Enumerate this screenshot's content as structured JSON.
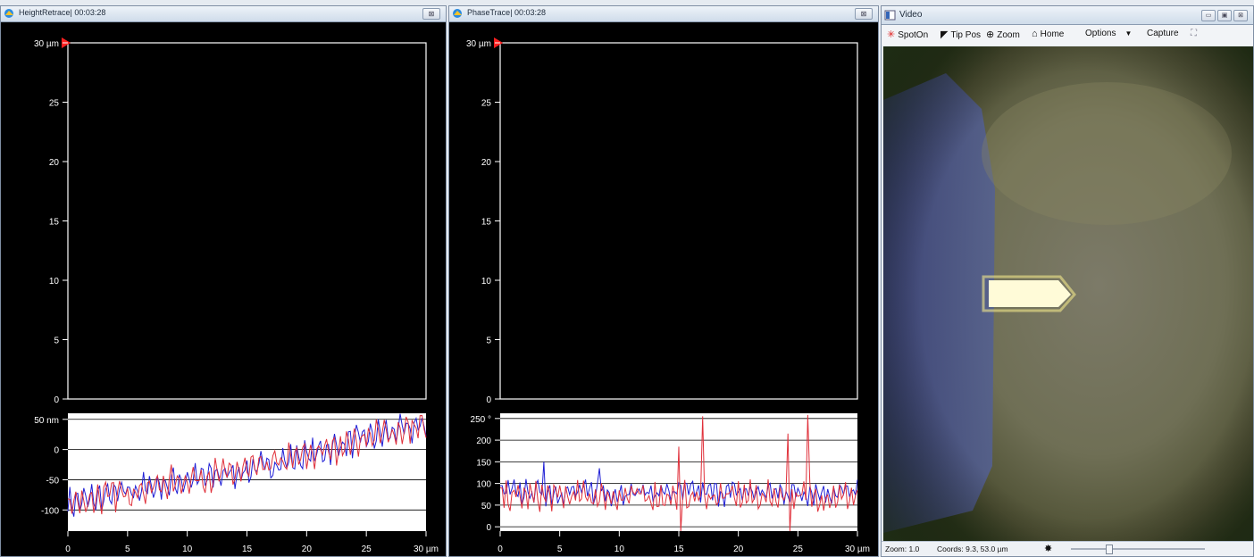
{
  "height_window": {
    "title": "HeightRetrace| 00:03:28",
    "close_label": "⊠",
    "image_y_ticks": [
      "30 µm",
      "25",
      "20",
      "15",
      "10",
      "5",
      "0"
    ],
    "profile_y_ticks": [
      "50 nm",
      "0",
      "-50",
      "-100"
    ],
    "x_ticks": [
      "0",
      "5",
      "10",
      "15",
      "20",
      "25",
      "30 µm"
    ]
  },
  "phase_window": {
    "title": "PhaseTrace| 00:03:28",
    "close_label": "⊠",
    "image_y_ticks": [
      "30 µm",
      "25",
      "20",
      "15",
      "10",
      "5",
      "0"
    ],
    "profile_y_ticks": [
      "250 °",
      "200",
      "150",
      "100",
      "50",
      "0"
    ],
    "x_ticks": [
      "0",
      "5",
      "10",
      "15",
      "20",
      "25",
      "30 µm"
    ]
  },
  "video_window": {
    "title": "Video",
    "toolbar": {
      "spoton": "SpotOn",
      "tip_pos": "Tip Pos",
      "zoom": "Zoom",
      "home": "Home",
      "options": "Options",
      "capture": "Capture"
    },
    "status": {
      "zoom": "Zoom: 1.0",
      "coords": "Coords: 9.3, 53.0 µm"
    },
    "slider_value": 0.28
  },
  "colors": {
    "trace": "#1f1fd6",
    "retrace": "#e0303a",
    "marker": "#ff2020",
    "tip": "#fffbd8"
  },
  "chart_data": [
    {
      "type": "line",
      "name": "HeightRetrace profile",
      "x_range": [
        0,
        30
      ],
      "y_range": [
        -135,
        60
      ],
      "y_ticks": [
        50,
        0,
        -50,
        -100
      ],
      "grid": true,
      "series": [
        {
          "color": "blue",
          "pattern": "oscillating",
          "x": [
            0,
            5,
            10,
            15,
            20,
            25,
            30
          ],
          "center": [
            -90,
            -70,
            -50,
            -35,
            -10,
            20,
            40
          ],
          "amplitude": 28
        },
        {
          "color": "red",
          "pattern": "oscillating",
          "x": [
            0,
            5,
            10,
            15,
            20,
            25,
            30
          ],
          "center": [
            -90,
            -70,
            -50,
            -35,
            -10,
            20,
            40
          ],
          "amplitude": 30
        }
      ]
    },
    {
      "type": "line",
      "name": "PhaseTrace profile",
      "x_range": [
        0,
        30
      ],
      "y_range": [
        -10,
        262
      ],
      "y_ticks": [
        250,
        200,
        150,
        100,
        50,
        0
      ],
      "grid": true,
      "series": [
        {
          "color": "blue",
          "pattern": "oscillating",
          "baseline": 80,
          "amplitude": 35,
          "spikes": [
            {
              "x": 3.7,
              "y": 150
            },
            {
              "x": 8.4,
              "y": 135
            }
          ]
        },
        {
          "color": "red",
          "pattern": "oscillating",
          "baseline": 70,
          "amplitude": 40,
          "spikes": [
            {
              "x": 15,
              "y": 185
            },
            {
              "x": 17,
              "y": 255
            },
            {
              "x": 24.2,
              "y": 215
            },
            {
              "x": 25.9,
              "y": 258
            },
            {
              "x": 15.1,
              "y": -10
            },
            {
              "x": 24.4,
              "y": -10
            }
          ]
        }
      ]
    }
  ]
}
